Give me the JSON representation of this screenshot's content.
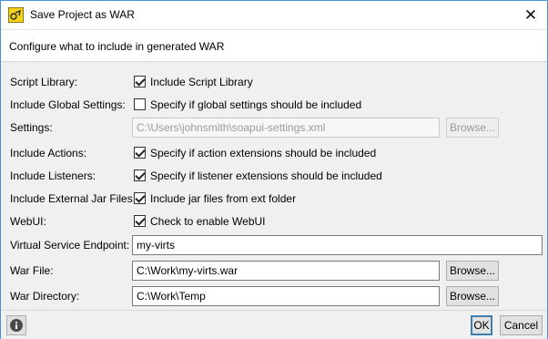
{
  "window": {
    "title": "Save Project as WAR",
    "close_glyph": "✕"
  },
  "header": {
    "text": "Configure what to include in generated WAR"
  },
  "form": {
    "script_library": {
      "label": "Script Library:",
      "checked": true,
      "text": "Include Script Library"
    },
    "global_settings": {
      "label": "Include Global Settings:",
      "checked": false,
      "text": "Specify if global settings should be included"
    },
    "settings": {
      "label": "Settings:",
      "value": "C:\\Users\\johnsmith\\soapui-settings.xml",
      "button": "Browse...",
      "disabled": true
    },
    "actions": {
      "label": "Include Actions:",
      "checked": true,
      "text": "Specify if action extensions should be included"
    },
    "listeners": {
      "label": "Include Listeners:",
      "checked": true,
      "text": "Specify if listener extensions should be included"
    },
    "external_jars": {
      "label": "Include External Jar Files:",
      "checked": true,
      "text": "Include jar files from ext folder"
    },
    "webui": {
      "label": "WebUI:",
      "checked": true,
      "text": "Check to enable WebUI"
    },
    "endpoint": {
      "label": "Virtual Service Endpoint:",
      "value": "my-virts"
    },
    "war_file": {
      "label": "War File:",
      "value": "C:\\Work\\my-virts.war",
      "button": "Browse..."
    },
    "war_directory": {
      "label": "War Directory:",
      "value": "C:\\Work\\Temp",
      "button": "Browse..."
    }
  },
  "footer": {
    "ok_label": "OK",
    "cancel_label": "Cancel",
    "info_icon": "info-icon"
  }
}
